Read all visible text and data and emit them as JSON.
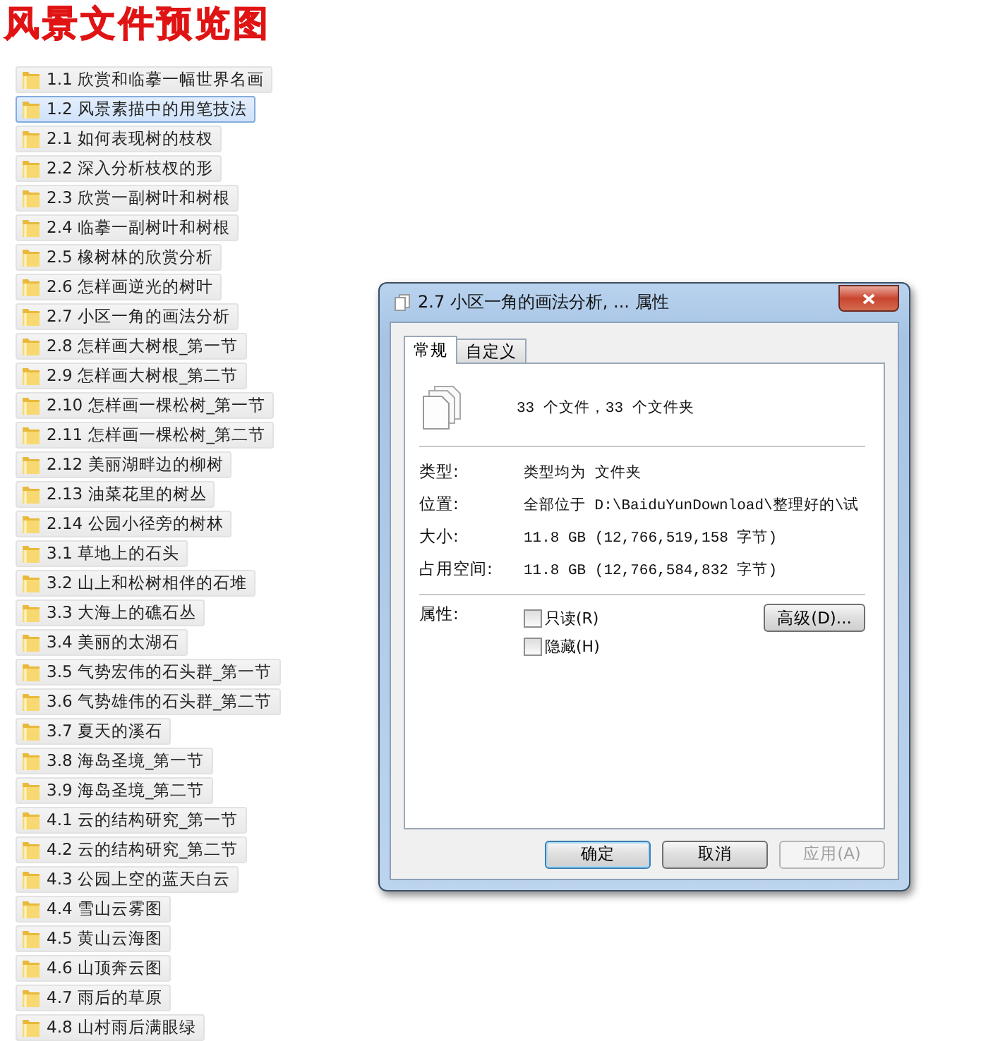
{
  "page_title": "风景文件预览图",
  "folders": [
    {
      "label": "1.1 欣赏和临摹一幅世界名画",
      "selected": false
    },
    {
      "label": "1.2 风景素描中的用笔技法",
      "selected": true
    },
    {
      "label": "2.1 如何表现树的枝杈",
      "selected": false
    },
    {
      "label": "2.2 深入分析枝杈的形",
      "selected": false
    },
    {
      "label": "2.3 欣赏一副树叶和树根",
      "selected": false
    },
    {
      "label": "2.4 临摹一副树叶和树根",
      "selected": false
    },
    {
      "label": "2.5 橡树林的欣赏分析",
      "selected": false
    },
    {
      "label": "2.6 怎样画逆光的树叶",
      "selected": false
    },
    {
      "label": "2.7 小区一角的画法分析",
      "selected": false
    },
    {
      "label": "2.8 怎样画大树根_第一节",
      "selected": false
    },
    {
      "label": "2.9 怎样画大树根_第二节",
      "selected": false
    },
    {
      "label": "2.10 怎样画一棵松树_第一节",
      "selected": false
    },
    {
      "label": "2.11 怎样画一棵松树_第二节",
      "selected": false
    },
    {
      "label": "2.12 美丽湖畔边的柳树",
      "selected": false
    },
    {
      "label": "2.13 油菜花里的树丛",
      "selected": false
    },
    {
      "label": "2.14 公园小径旁的树林",
      "selected": false
    },
    {
      "label": "3.1 草地上的石头",
      "selected": false
    },
    {
      "label": "3.2 山上和松树相伴的石堆",
      "selected": false
    },
    {
      "label": "3.3 大海上的礁石丛",
      "selected": false
    },
    {
      "label": "3.4 美丽的太湖石",
      "selected": false
    },
    {
      "label": "3.5 气势宏伟的石头群_第一节",
      "selected": false
    },
    {
      "label": "3.6 气势雄伟的石头群_第二节",
      "selected": false
    },
    {
      "label": "3.7 夏天的溪石",
      "selected": false
    },
    {
      "label": "3.8 海岛圣境_第一节",
      "selected": false
    },
    {
      "label": "3.9 海岛圣境_第二节",
      "selected": false
    },
    {
      "label": "4.1 云的结构研究_第一节",
      "selected": false
    },
    {
      "label": "4.2 云的结构研究_第二节",
      "selected": false
    },
    {
      "label": "4.3 公园上空的蓝天白云",
      "selected": false
    },
    {
      "label": "4.4 雪山云雾图",
      "selected": false
    },
    {
      "label": "4.5 黄山云海图",
      "selected": false
    },
    {
      "label": "4.6 山顶奔云图",
      "selected": false
    },
    {
      "label": "4.7 雨后的草原",
      "selected": false
    },
    {
      "label": "4.8 山村雨后满眼绿",
      "selected": false
    }
  ],
  "dialog": {
    "title": "2.7 小区一角的画法分析, ... 属性",
    "tabs": [
      {
        "label": "常规",
        "selected": true
      },
      {
        "label": "自定义",
        "selected": false
      }
    ],
    "summary": "33 个文件，33 个文件夹",
    "fields": [
      {
        "label": "类型:",
        "value": "类型均为 文件夹"
      },
      {
        "label": "位置:",
        "value": "全部位于 D:\\BaiduYunDownload\\整理好的\\试"
      },
      {
        "label": "大小:",
        "value": "11.8 GB (12,766,519,158 字节)"
      },
      {
        "label": "占用空间:",
        "value": "11.8 GB (12,766,584,832 字节)"
      }
    ],
    "attributes_label": "属性:",
    "checkboxes": [
      {
        "label": "只读(R)",
        "checked": false
      },
      {
        "label": "隐藏(H)",
        "checked": false
      }
    ],
    "advanced_button": "高级(D)...",
    "buttons": [
      {
        "label": "确定",
        "kind": "default",
        "disabled": false
      },
      {
        "label": "取消",
        "kind": "normal",
        "disabled": false
      },
      {
        "label": "应用(A)",
        "kind": "normal",
        "disabled": true
      }
    ]
  }
}
